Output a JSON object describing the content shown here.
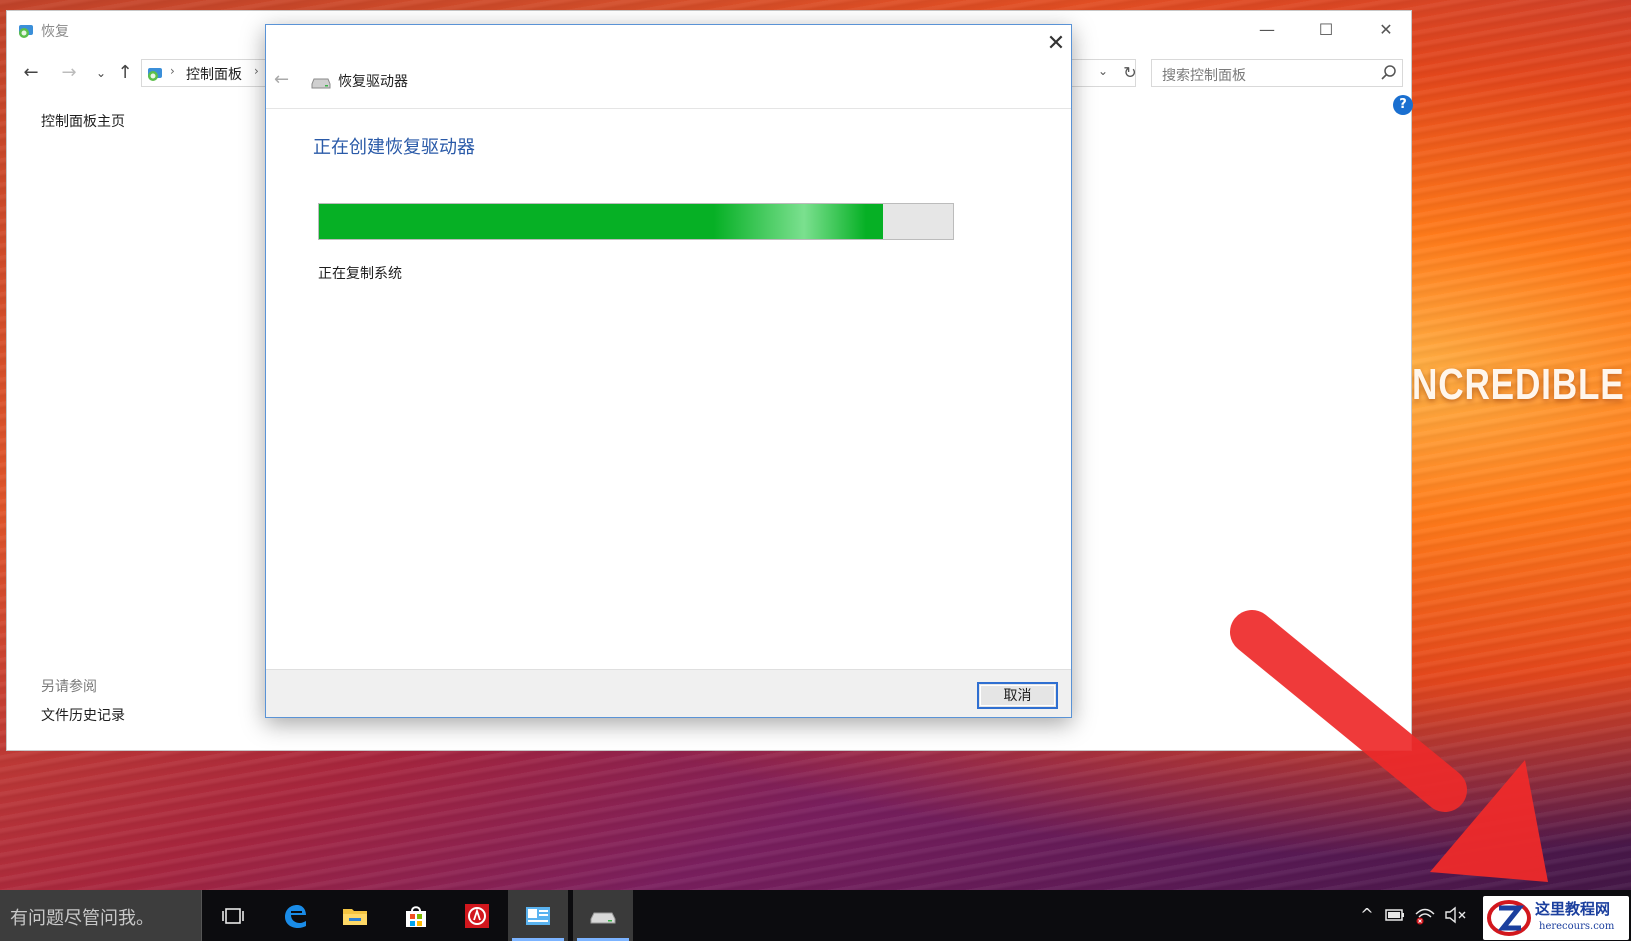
{
  "wallpaper": {
    "text": "NCREDIBLE"
  },
  "control_panel": {
    "title": "恢复",
    "breadcrumb": "控制面板",
    "search_placeholder": "搜索控制面板",
    "help_label": "?",
    "sidebar": {
      "home": "控制面板主页",
      "see_also": "另请参阅",
      "file_history": "文件历史记录"
    },
    "window_buttons": {
      "minimize": "—",
      "maximize": "☐",
      "close": "✕"
    }
  },
  "dialog": {
    "title": "恢复驱动器",
    "heading": "正在创建恢复驱动器",
    "progress": {
      "fraction": 0.89,
      "status": "正在复制系统"
    },
    "cancel_label": "取消",
    "close_label": "✕",
    "back_label": "←"
  },
  "taskbar": {
    "search_text": "有问题尽管问我。",
    "apps": [
      {
        "name": "task-view-icon"
      },
      {
        "name": "edge-icon"
      },
      {
        "name": "file-explorer-icon"
      },
      {
        "name": "store-icon"
      },
      {
        "name": "app-red-icon"
      },
      {
        "name": "control-panel-icon"
      },
      {
        "name": "recovery-drive-icon"
      }
    ],
    "tray": [
      "chevron-up-icon",
      "battery-icon",
      "network-icon",
      "volume-muted-icon"
    ]
  },
  "watermark": {
    "title": "这里教程网",
    "url": "herecours.com"
  },
  "colors": {
    "accent": "#2a5aa8",
    "progress": "#06b025",
    "annotation_arrow": "#ee2a2a"
  }
}
